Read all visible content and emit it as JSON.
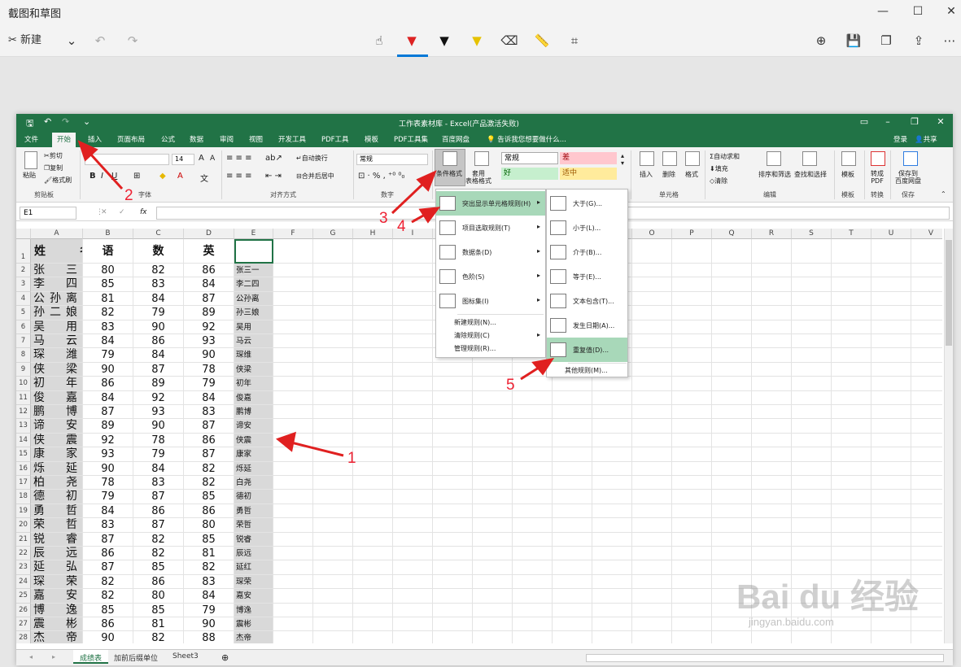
{
  "snip": {
    "title": "截图和草图",
    "new_label": "新建"
  },
  "excel": {
    "title": "工作表素材库 - Excel(产品激活失败)",
    "login": "登录",
    "share": "共享",
    "tabs": [
      "文件",
      "开始",
      "插入",
      "页面布局",
      "公式",
      "数据",
      "审阅",
      "视图",
      "开发工具",
      "PDF工具",
      "模板",
      "PDF工具集",
      "百度网盘"
    ],
    "tell_me": "告诉我您想要做什么...",
    "ribbon": {
      "clipboard": {
        "cut": "剪切",
        "copy": "复制",
        "painter": "格式刷",
        "paste": "粘贴",
        "label": "剪贴板"
      },
      "font": {
        "size": "14",
        "bold": "B",
        "italic": "I",
        "underline": "U",
        "label": "字体"
      },
      "align": {
        "wrap": "自动换行",
        "merge": "合并后居中",
        "label": "对齐方式"
      },
      "number": {
        "format": "常规",
        "label": "数字"
      },
      "styles": {
        "cond": "条件格式",
        "table": "套用\n表格格式",
        "normal": "常规",
        "bad": "差",
        "good": "好",
        "neutral": "适中"
      },
      "cells": {
        "insert": "插入",
        "delete": "删除",
        "format": "格式",
        "label": "单元格"
      },
      "edit": {
        "autosum": "自动求和",
        "fill": "填充",
        "clear": "清除",
        "sort": "排序和筛选",
        "find": "查找和选择",
        "label": "编辑"
      },
      "template": {
        "btn": "模板",
        "label": "模板"
      },
      "convert": {
        "btn": "转成\nPDF",
        "label": "转换"
      },
      "save": {
        "btn": "保存到\n百度网盘",
        "label": "保存"
      }
    },
    "name_box": "E1",
    "columns": [
      "A",
      "B",
      "C",
      "D",
      "E",
      "F",
      "G",
      "H",
      "I",
      "J",
      "K",
      "L",
      "M",
      "N",
      "O",
      "P",
      "Q",
      "R",
      "S",
      "T",
      "U",
      "V"
    ],
    "header_row": [
      "姓　名",
      "语",
      "数",
      "英",
      ""
    ],
    "rows": [
      [
        "张　三",
        80,
        82,
        86,
        "张三一"
      ],
      [
        "李　四",
        85,
        83,
        84,
        "李二四"
      ],
      [
        "公孙离",
        81,
        84,
        87,
        "公孙离"
      ],
      [
        "孙二娘",
        82,
        79,
        89,
        "孙三娘"
      ],
      [
        "吴　用",
        83,
        90,
        92,
        "吴用"
      ],
      [
        "马　云",
        84,
        86,
        93,
        "马云"
      ],
      [
        "琛　潍",
        79,
        84,
        90,
        "琛维"
      ],
      [
        "侠　梁",
        90,
        87,
        78,
        "侠梁"
      ],
      [
        "初　年",
        86,
        89,
        79,
        "初年"
      ],
      [
        "俊　嘉",
        84,
        92,
        84,
        "俊嘉"
      ],
      [
        "鹏　博",
        87,
        93,
        83,
        "鹏博"
      ],
      [
        "谛　安",
        89,
        90,
        87,
        "谛安"
      ],
      [
        "侠　震",
        92,
        78,
        86,
        "侠震"
      ],
      [
        "康　家",
        93,
        79,
        87,
        "康家"
      ],
      [
        "烁　延",
        90,
        84,
        82,
        "烁延"
      ],
      [
        "柏　尧",
        78,
        83,
        82,
        "白尧"
      ],
      [
        "德　初",
        79,
        87,
        85,
        "德初"
      ],
      [
        "勇　哲",
        84,
        86,
        86,
        "勇哲"
      ],
      [
        "荣　哲",
        83,
        87,
        80,
        "荣哲"
      ],
      [
        "锐　睿",
        87,
        82,
        85,
        "锐睿"
      ],
      [
        "辰　远",
        86,
        82,
        81,
        "辰远"
      ],
      [
        "延　弘",
        87,
        85,
        82,
        "延红"
      ],
      [
        "琛　荣",
        82,
        86,
        83,
        "琛荣"
      ],
      [
        "嘉　安",
        82,
        80,
        84,
        "嘉安"
      ],
      [
        "博　逸",
        85,
        85,
        79,
        "博逸"
      ],
      [
        "震　彬",
        86,
        81,
        90,
        "震彬"
      ],
      [
        "杰　帝",
        90,
        82,
        88,
        "杰帝"
      ]
    ],
    "sheets": [
      "成绩表",
      "加前后缀单位",
      "Sheet3"
    ]
  },
  "menu_cf": {
    "items": [
      "突出显示单元格规则(H)",
      "项目选取规则(T)",
      "数据条(D)",
      "色阶(S)",
      "图标集(I)"
    ],
    "small_items": [
      "新建规则(N)...",
      "清除规则(C)",
      "管理规则(R)..."
    ]
  },
  "menu_hl": {
    "items": [
      "大于(G)...",
      "小于(L)...",
      "介于(B)...",
      "等于(E)...",
      "文本包含(T)...",
      "发生日期(A)...",
      "重复值(D)..."
    ],
    "more": "其他规则(M)..."
  },
  "annotations": [
    "1",
    "2",
    "3",
    "4",
    "5"
  ],
  "watermark": {
    "main": "Bai du 经验",
    "sub": "jingyan.baidu.com"
  },
  "colors": {
    "excel_green": "#217346",
    "arrow_red": "#e02020",
    "menu_highlight": "#a8d8b9"
  }
}
